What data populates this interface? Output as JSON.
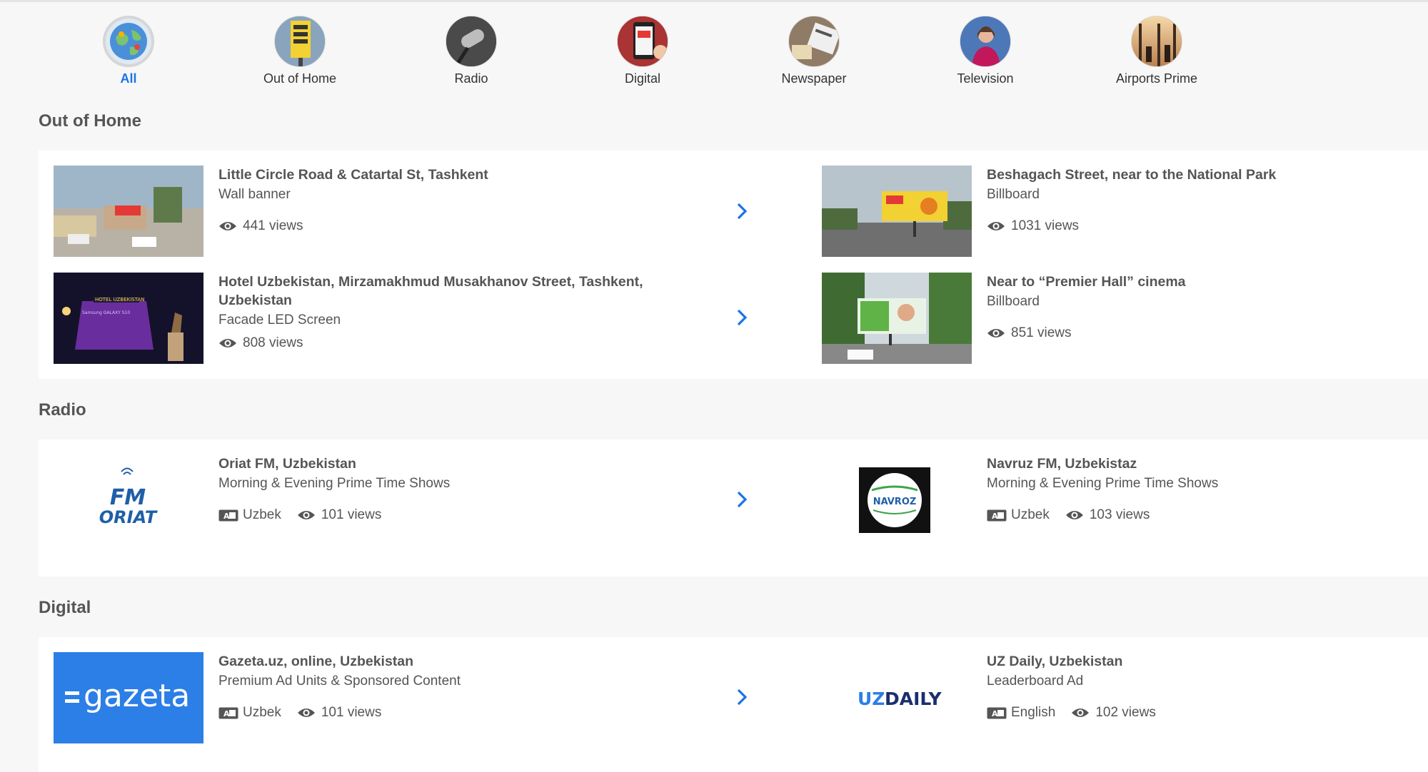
{
  "categories": [
    {
      "label": "All",
      "active": true,
      "icon": "globe-icon"
    },
    {
      "label": "Out of Home",
      "active": false,
      "icon": "billboard-photo"
    },
    {
      "label": "Radio",
      "active": false,
      "icon": "microphone-photo"
    },
    {
      "label": "Digital",
      "active": false,
      "icon": "smartphone-photo"
    },
    {
      "label": "Newspaper",
      "active": false,
      "icon": "newspaper-photo"
    },
    {
      "label": "Television",
      "active": false,
      "icon": "tv-presenter-photo"
    },
    {
      "label": "Airports Prime",
      "active": false,
      "icon": "airport-photo"
    }
  ],
  "sections": {
    "out_of_home": {
      "title": "Out of Home",
      "items": [
        {
          "title": "Little Circle Road & Catartal St, Tashkent",
          "type": "Wall banner",
          "views": "441 views"
        },
        {
          "title": "Beshagach Street, near to the National Park",
          "type": "Billboard",
          "views": "1031 views"
        },
        {
          "title": "Hotel Uzbekistan, Mirzamakhmud Musakhanov Street, Tashkent,",
          "title2": "Uzbekistan",
          "type": "Facade LED Screen",
          "views": "808 views",
          "sign": "HOTEL UZBEKISTAN",
          "screen_text": "Samsung GALAXY S10"
        },
        {
          "title": "Near to “Premier Hall” cinema",
          "type": "Billboard",
          "views": "851 views"
        }
      ]
    },
    "radio": {
      "title": "Radio",
      "items": [
        {
          "title": "Oriat FM, Uzbekistan",
          "type": "Morning & Evening Prime Time Shows",
          "language": "Uzbek",
          "views": "101 views",
          "logo_top": "FM",
          "logo_bottom": "ORIAT"
        },
        {
          "title": "Navruz FM, Uzbekistaz",
          "type": "Morning & Evening Prime Time Shows",
          "language": "Uzbek",
          "views": "103 views",
          "logo": "NAVROZ"
        }
      ]
    },
    "digital": {
      "title": "Digital",
      "items": [
        {
          "title": "Gazeta.uz, online, Uzbekistan",
          "type": "Premium Ad Units & Sponsored Content",
          "language": "Uzbek",
          "views": "101 views",
          "logo": "gazeta"
        },
        {
          "title": "UZ Daily, Uzbekistan",
          "type": "Leaderboard Ad",
          "language": "English",
          "views": "102 views",
          "logo_a": "UZ",
          "logo_b": "DAILY"
        }
      ]
    }
  },
  "colors": {
    "accent": "#1a73e8",
    "text": "#555555",
    "background": "#f7f7f7",
    "panel": "#ffffff",
    "gazeta_blue": "#2b7fe6",
    "uzdaily_navy": "#1b2f6e"
  }
}
